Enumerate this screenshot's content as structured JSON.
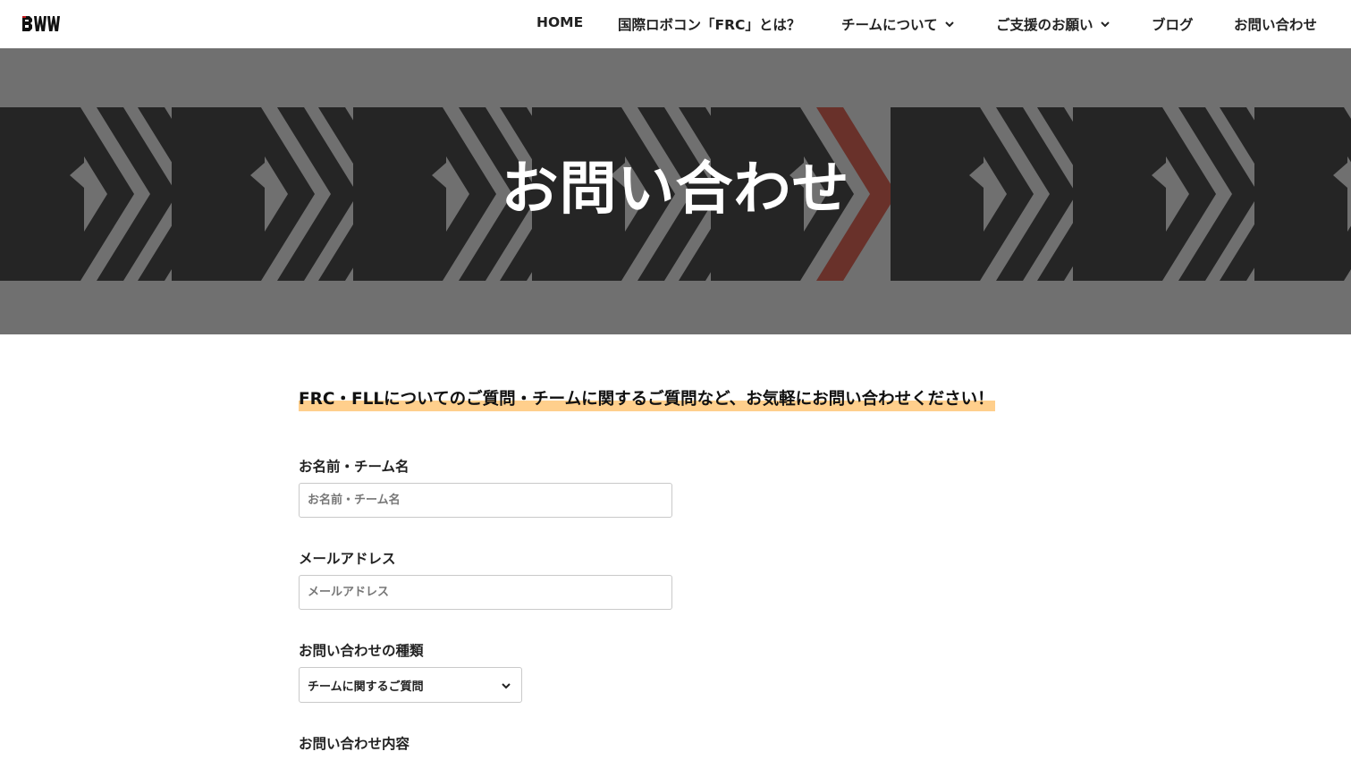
{
  "header": {
    "logo_text": "BWW",
    "nav": [
      {
        "label": "HOME",
        "has_dropdown": false
      },
      {
        "label": "国際ロボコン「FRC」とは？",
        "has_dropdown": false
      },
      {
        "label": "チームについて",
        "has_dropdown": true
      },
      {
        "label": "ご支援のお願い",
        "has_dropdown": true
      },
      {
        "label": "ブログ",
        "has_dropdown": false
      },
      {
        "label": "お問い合わせ",
        "has_dropdown": false
      }
    ]
  },
  "hero": {
    "title": "お問い合わせ",
    "accent_color": "#b3200f"
  },
  "main": {
    "lead": "FRC・FLLについてのご質問・チームに関するご質問など、お気軽にお問い合わせください！",
    "highlight_color": "#ffcf8c",
    "form": {
      "name": {
        "label": "お名前・チーム名",
        "placeholder": "お名前・チーム名",
        "value": ""
      },
      "email": {
        "label": "メールアドレス",
        "placeholder": "メールアドレス",
        "value": ""
      },
      "type": {
        "label": "お問い合わせの種類",
        "selected": "チームに関するご質問",
        "icon": "chevron-down-icon"
      },
      "message": {
        "label": "お問い合わせ内容"
      }
    }
  }
}
